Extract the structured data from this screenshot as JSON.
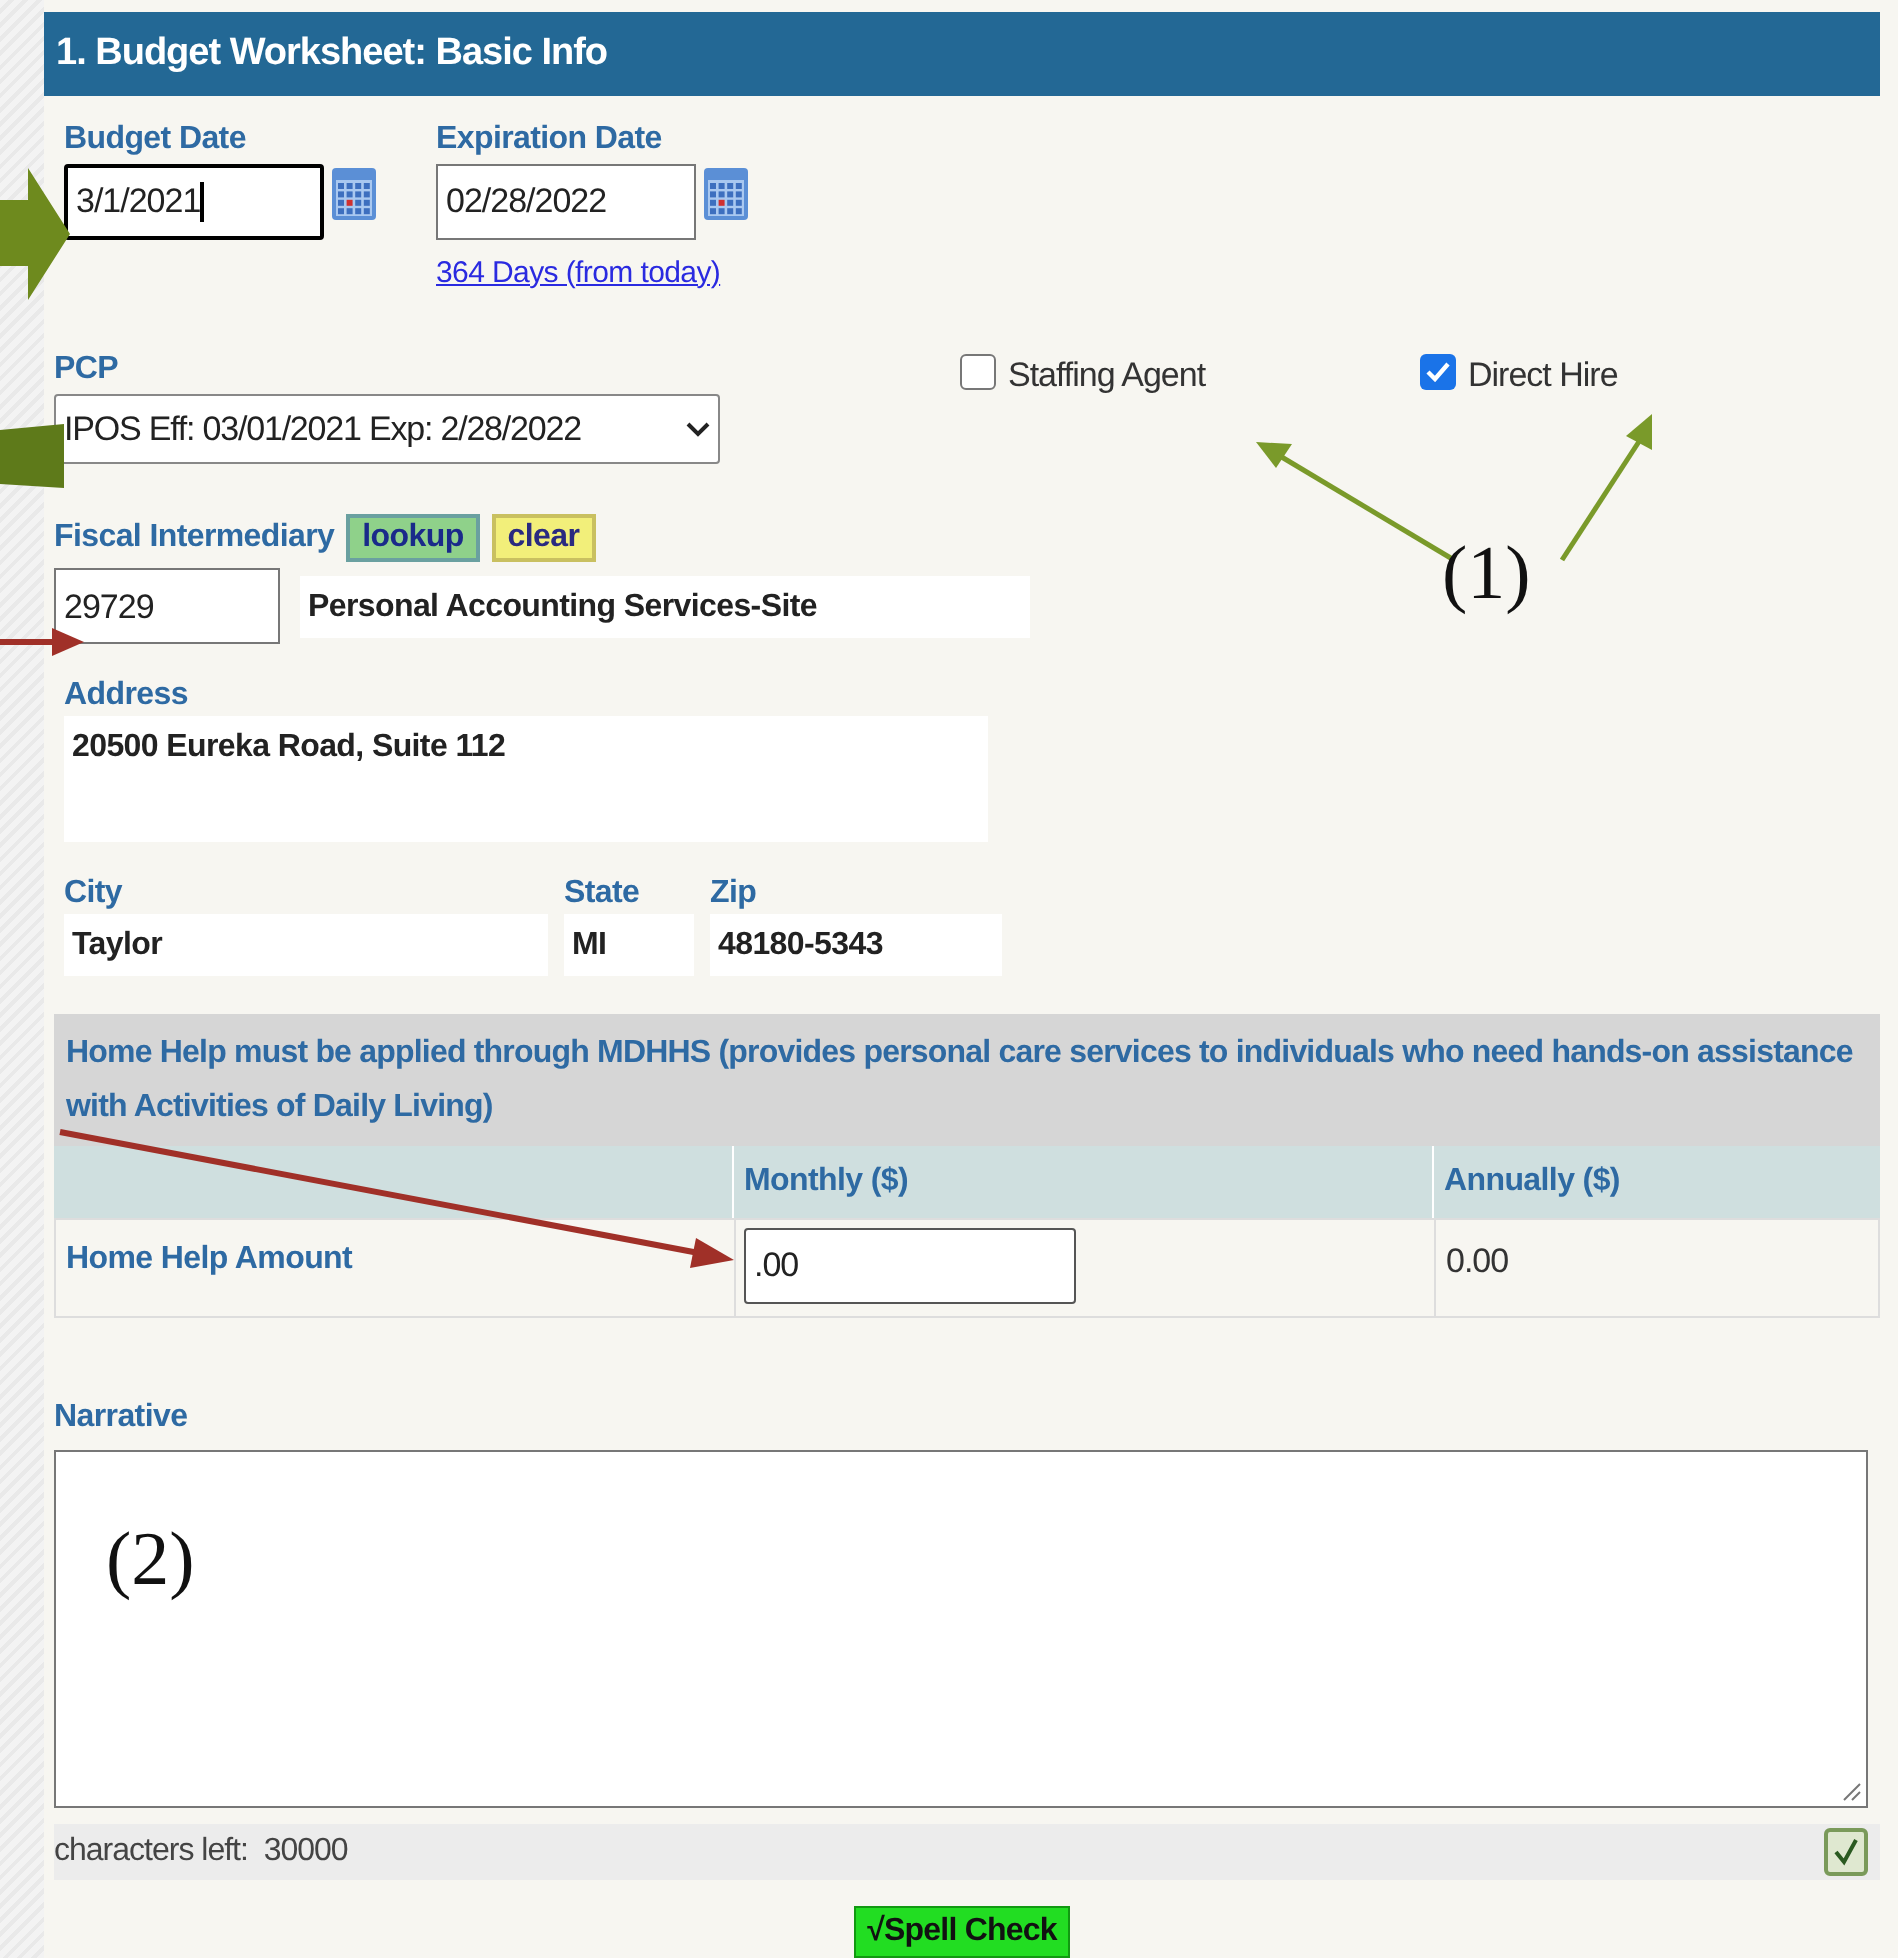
{
  "header": {
    "title": "1. Budget Worksheet: Basic Info"
  },
  "budget_date": {
    "label": "Budget Date",
    "value": "3/1/2021",
    "focused": true
  },
  "expiration_date": {
    "label": "Expiration Date",
    "value": "02/28/2022",
    "focused": false,
    "link": "364 Days (from today)"
  },
  "pcp": {
    "label": "PCP",
    "value": "IPOS Eff: 03/01/2021 Exp: 2/28/2022"
  },
  "hire_options": [
    {
      "label": "Staffing Agent",
      "checked": false
    },
    {
      "label": "Direct Hire",
      "checked": true
    }
  ],
  "fiscal_intermediary": {
    "label": "Fiscal Intermediary",
    "buttons": [
      {
        "label": "lookup",
        "kind": "lookup"
      },
      {
        "label": "clear",
        "kind": "clear"
      }
    ],
    "code": "29729",
    "name": "Personal Accounting Services-Site"
  },
  "address": {
    "label": "Address",
    "value": "20500 Eureka Road, Suite 112"
  },
  "city": {
    "label": "City",
    "value": "Taylor"
  },
  "state": {
    "label": "State",
    "value": "MI"
  },
  "zip": {
    "label": "Zip",
    "value": "48180-5343"
  },
  "home_help": {
    "note": "Home Help must be applied through MDHHS (provides personal care services to individuals who need hands-on assistance with Activities of Daily Living)",
    "columns": [
      "Monthly ($)",
      "Annually ($)"
    ],
    "row": {
      "label": "Home Help Amount",
      "monthly": ".00",
      "annually": "0.00"
    }
  },
  "narrative": {
    "label": "Narrative",
    "characters_left": "characters left:  30000"
  },
  "spell_check": {
    "label": "√Spell Check"
  },
  "annotations": [
    {
      "label": "(1)"
    },
    {
      "label": "(2)"
    }
  ]
}
